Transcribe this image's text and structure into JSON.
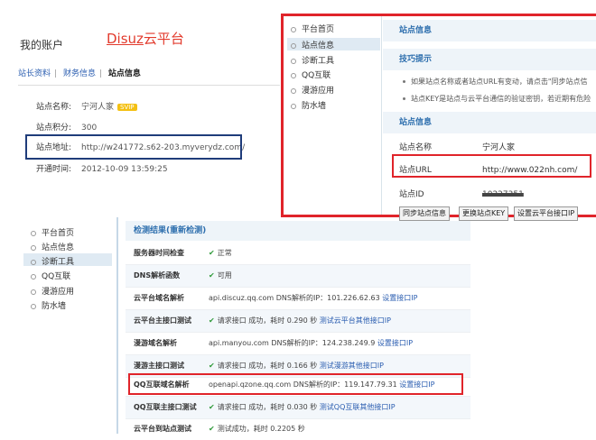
{
  "panel1": {
    "title": "我的账户",
    "brand_prefix": "Disuz",
    "brand_suffix": "云平台",
    "tabs": [
      "站长资料",
      "财务信息",
      "站点信息"
    ],
    "tab_sep": "|",
    "rows": [
      {
        "label": "站点名称:",
        "value": "宁河人家"
      },
      {
        "label": "站点积分:",
        "value": "300"
      },
      {
        "label": "站点地址:",
        "value": "http://w241772.s62-203.myverydz.com/"
      },
      {
        "label": "开通时间:",
        "value": "2012-10-09 13:59:25"
      }
    ],
    "badge_text": "SVIP"
  },
  "panel2": {
    "nav": [
      "平台首页",
      "站点信息",
      "诊断工具",
      "QQ互联",
      "漫游应用",
      "防水墙"
    ],
    "header_site_info": "站点信息",
    "header_tips": "技巧提示",
    "tips": [
      "如果站点名称或者站点URL有变动，请点击\"同步站点信",
      "站点KEY是站点与云平台通信的验证密钥，若近期有危险"
    ],
    "header_site_info2": "站点信息",
    "fields": [
      {
        "label": "站点名称",
        "value": "宁河人家"
      },
      {
        "label": "站点URL",
        "value": "http://www.022nh.com/"
      },
      {
        "label": "站点ID",
        "value": "10227351"
      }
    ],
    "buttons": [
      "同步站点信息",
      "更换站点KEY",
      "设置云平台接口IP"
    ]
  },
  "panel3": {
    "nav": [
      "平台首页",
      "站点信息",
      "诊断工具",
      "QQ互联",
      "漫游应用",
      "防水墙"
    ],
    "result_title": "检测结果(重新检测)",
    "rows": [
      {
        "label": "服务器时间检查",
        "check": "✔",
        "value": "正常",
        "link": ""
      },
      {
        "label": "DNS解析函数",
        "check": "✔",
        "value": "可用",
        "link": ""
      },
      {
        "label": "云平台域名解析",
        "check": "",
        "value": "api.discuz.qq.com DNS解析的IP：101.226.62.63",
        "link": "设置接口IP"
      },
      {
        "label": "云平台主接口测试",
        "check": "✔",
        "value": "请求接口 成功，耗时 0.290 秒",
        "link": "测试云平台其他接口IP"
      },
      {
        "label": "漫游域名解析",
        "check": "",
        "value": "api.manyou.com DNS解析的IP：124.238.249.9",
        "link": "设置接口IP"
      },
      {
        "label": "漫游主接口测试",
        "check": "✔",
        "value": "请求接口 成功，耗时 0.166 秒",
        "link": "测试漫游其他接口IP"
      },
      {
        "label": "QQ互联域名解析",
        "check": "",
        "value": "openapi.qzone.qq.com DNS解析的IP：119.147.79.31",
        "link": "设置接口IP"
      },
      {
        "label": "QQ互联主接口测试",
        "check": "✔",
        "value": "请求接口 成功，耗时 0.030 秒",
        "link": "测试QQ互联其他接口IP"
      },
      {
        "label": "云平台到站点测试",
        "check": "✔",
        "value": "测试成功，耗时 0.2205 秒",
        "link": ""
      }
    ]
  },
  "colors": {
    "accent_red": "#e0242a",
    "nav_blue": "#2e6fae",
    "link_blue": "#2a5db0",
    "check_green": "#2f9a3a"
  }
}
